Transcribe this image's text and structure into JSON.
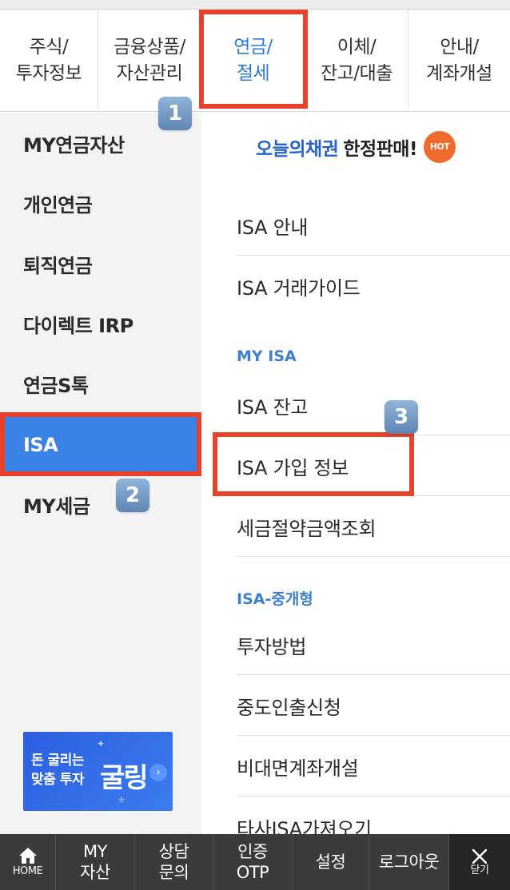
{
  "tabs": [
    {
      "label": "주식/\n투자정보"
    },
    {
      "label": "금융상품/\n자산관리"
    },
    {
      "label": "연금/\n절세"
    },
    {
      "label": "이체/\n잔고/대출"
    },
    {
      "label": "안내/\n계좌개설"
    }
  ],
  "left_menu": [
    {
      "label": "MY연금자산"
    },
    {
      "label": "개인연금"
    },
    {
      "label": "퇴직연금"
    },
    {
      "label": "다이렉트 IRP"
    },
    {
      "label": "연금S톡"
    },
    {
      "label": "ISA"
    },
    {
      "label": "MY세금"
    }
  ],
  "banner": {
    "line1": "돈 굴리는",
    "line2": "맞춤 투자",
    "brand": "굴링",
    "arrow": "›",
    "spark": "✦",
    "spark_small": "+"
  },
  "promo": {
    "highlight": "오늘의채권",
    "text": "한정판매!",
    "badge": "HOT"
  },
  "right_menu": {
    "items_a": [
      "ISA 안내",
      "ISA 거래가이드"
    ],
    "section_my_isa": "MY ISA",
    "items_b": [
      "ISA 잔고",
      "ISA 가입 정보",
      "세금절약금액조회"
    ],
    "section_isa_brokerage": "ISA-중개형",
    "items_c": [
      "투자방법",
      "중도인출신청",
      "비대면계좌개설",
      "타사ISA가져오기"
    ]
  },
  "annotations": {
    "n1": "1",
    "n2": "2",
    "n3": "3",
    "color": "#e8412c"
  },
  "bottom_bar": [
    {
      "label": "HOME"
    },
    {
      "label": "MY\n자산"
    },
    {
      "label": "상담\n문의"
    },
    {
      "label": "인증\nOTP"
    },
    {
      "label": "설정"
    },
    {
      "label": "로그아웃"
    },
    {
      "label": "닫기"
    }
  ],
  "colors": {
    "accent": "#3b82e6",
    "active_tab_text": "#2b7bd6",
    "section_text": "#3f7fd0",
    "bottom_bar": "#3b3b3b"
  }
}
